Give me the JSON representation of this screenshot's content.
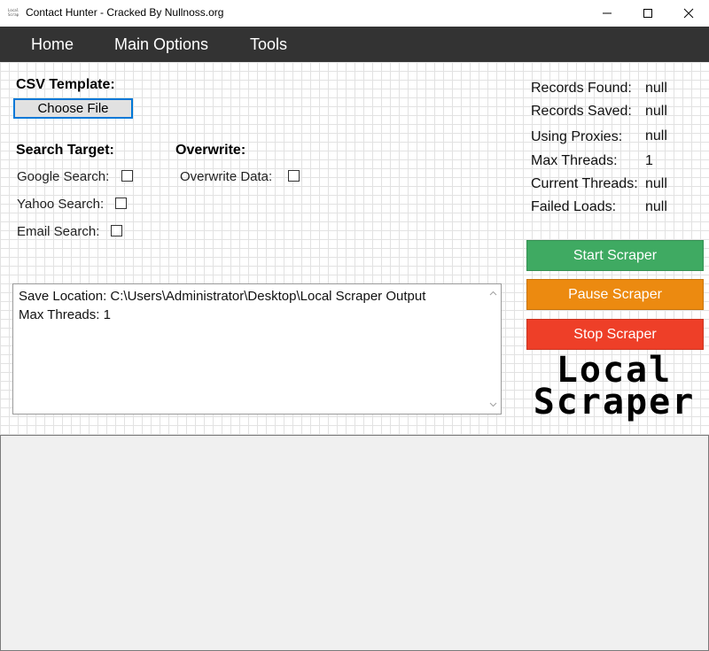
{
  "window": {
    "title": "Contact Hunter - Cracked By Nullnoss.org",
    "icon_text": "Local Scraper"
  },
  "menu": {
    "items": [
      "Home",
      "Main Options",
      "Tools"
    ]
  },
  "csv": {
    "heading": "CSV Template:",
    "choose_file_label": "Choose File"
  },
  "search_target": {
    "heading": "Search Target:",
    "options": [
      {
        "label": "Google Search:",
        "checked": false
      },
      {
        "label": "Yahoo Search:",
        "checked": false
      },
      {
        "label": "Email Search:",
        "checked": false
      }
    ]
  },
  "overwrite": {
    "heading": "Overwrite:",
    "option_label": "Overwrite Data:",
    "checked": false
  },
  "stats": [
    {
      "label": "Records Found:",
      "value": "null"
    },
    {
      "label": "Records Saved:",
      "value": "null"
    },
    {
      "label": "Using Proxies:",
      "value": "null"
    },
    {
      "label": "Max Threads:",
      "value": "1"
    },
    {
      "label": "Current Threads:",
      "value": "null"
    },
    {
      "label": "Failed Loads:",
      "value": "null"
    }
  ],
  "actions": {
    "start": {
      "label": "Start Scraper",
      "color": "#3faa62"
    },
    "pause": {
      "label": "Pause Scraper",
      "color": "#ec8a10"
    },
    "stop": {
      "label": "Stop Scraper",
      "color": "#ee3f28"
    }
  },
  "logo": {
    "line1": "Local",
    "line2": "Scraper"
  },
  "log": {
    "lines": [
      "Save Location: C:\\Users\\Administrator\\Desktop\\Local Scraper Output",
      "Max Threads: 1"
    ]
  },
  "icons": {
    "minimize": "minimize-icon",
    "maximize": "maximize-icon",
    "close": "close-icon",
    "scroll_up": "chevron-up-icon",
    "scroll_down": "chevron-down-icon"
  }
}
